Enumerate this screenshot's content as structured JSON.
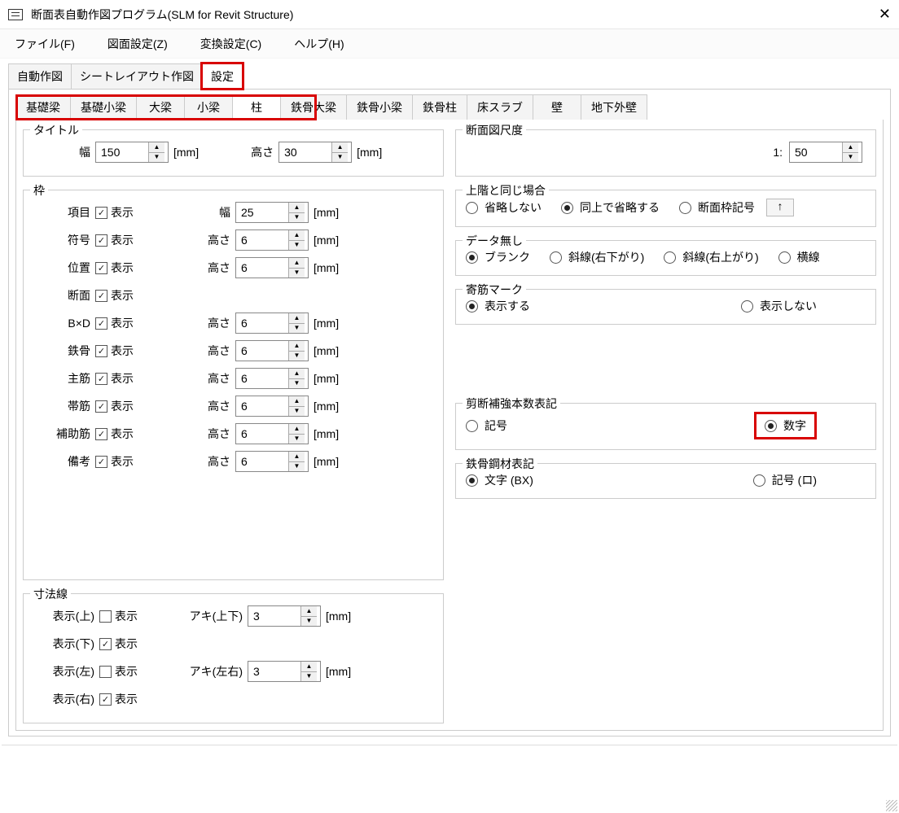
{
  "window": {
    "title": "断面表自動作図プログラム(SLM for Revit Structure)"
  },
  "menu": {
    "file": "ファイル(F)",
    "drawing": "図面設定(Z)",
    "convert": "変換設定(C)",
    "help": "ヘルプ(H)"
  },
  "tabs": {
    "auto": "自動作図",
    "sheet": "シートレイアウト作図",
    "settings": "設定"
  },
  "subtabs": {
    "t0": "基礎梁",
    "t1": "基礎小梁",
    "t2": "大梁",
    "t3": "小梁",
    "t4": "柱",
    "t5": "鉄骨大梁",
    "t6": "鉄骨小梁",
    "t7": "鉄骨柱",
    "t8": "床スラブ",
    "t9": "壁",
    "t10": "地下外壁"
  },
  "common": {
    "show": "表示",
    "mm": "[mm]",
    "width": "幅",
    "height": "高さ"
  },
  "title_group": {
    "legend": "タイトル",
    "width_val": "150",
    "height_val": "30"
  },
  "frame": {
    "legend": "枠",
    "rows": [
      {
        "label": "項目",
        "dim": "幅",
        "val": "25"
      },
      {
        "label": "符号",
        "dim": "高さ",
        "val": "6"
      },
      {
        "label": "位置",
        "dim": "高さ",
        "val": "6"
      },
      {
        "label": "断面",
        "dim": null,
        "val": null
      },
      {
        "label": "B×D",
        "dim": "高さ",
        "val": "6"
      },
      {
        "label": "鉄骨",
        "dim": "高さ",
        "val": "6"
      },
      {
        "label": "主筋",
        "dim": "高さ",
        "val": "6"
      },
      {
        "label": "帯筋",
        "dim": "高さ",
        "val": "6"
      },
      {
        "label": "補助筋",
        "dim": "高さ",
        "val": "6"
      },
      {
        "label": "備考",
        "dim": "高さ",
        "val": "6"
      }
    ]
  },
  "dimline": {
    "legend": "寸法線",
    "rows": [
      {
        "label": "表示(上)",
        "checked": false,
        "aki_label": "アキ(上下)",
        "aki_val": "3"
      },
      {
        "label": "表示(下)",
        "checked": true,
        "aki_label": null,
        "aki_val": null
      },
      {
        "label": "表示(左)",
        "checked": false,
        "aki_label": "アキ(左右)",
        "aki_val": "3"
      },
      {
        "label": "表示(右)",
        "checked": true,
        "aki_label": null,
        "aki_val": null
      }
    ]
  },
  "scale": {
    "legend": "断面図尺度",
    "prefix": "1:",
    "val": "50"
  },
  "same_upper": {
    "legend": "上階と同じ場合",
    "o0": "省略しない",
    "o1": "同上で省略する",
    "o2": "断面枠記号",
    "arrow": "↑"
  },
  "no_data": {
    "legend": "データ無し",
    "o0": "ブランク",
    "o1": "斜線(右下がり)",
    "o2": "斜線(右上がり)",
    "o3": "横線"
  },
  "yose": {
    "legend": "寄筋マーク",
    "o0": "表示する",
    "o1": "表示しない"
  },
  "shear": {
    "legend": "剪断補強本数表記",
    "o0": "記号",
    "o1": "数字"
  },
  "steel_mat": {
    "legend": "鉄骨鋼材表記",
    "o0": "文字 (BX)",
    "o1": "記号 (ロ)"
  }
}
